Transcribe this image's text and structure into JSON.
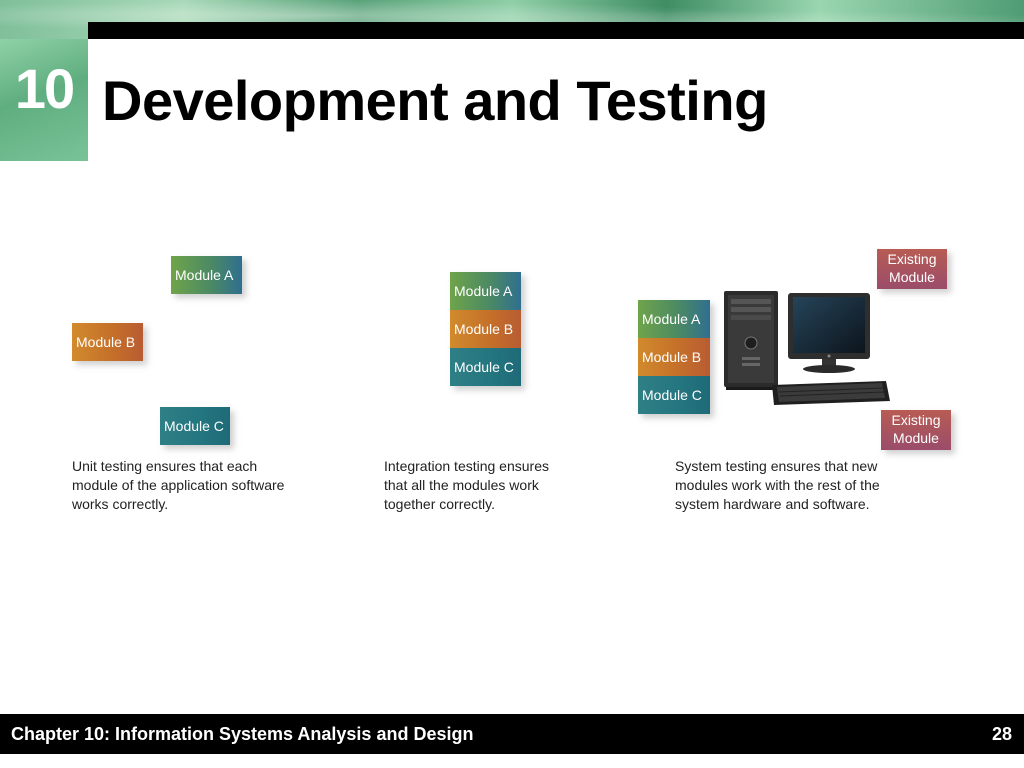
{
  "slide": {
    "chapter_number": "10",
    "title": "Development and Testing"
  },
  "unit_testing": {
    "modules": [
      "Module A",
      "Module B",
      "Module C"
    ],
    "caption_lines": [
      "Unit testing ensures that each",
      "module of the application software",
      "works correctly."
    ]
  },
  "integration_testing": {
    "modules": [
      "Module A",
      "Module B",
      "Module C"
    ],
    "caption_lines": [
      "Integration testing ensures",
      "that all the modules work",
      "together correctly."
    ]
  },
  "system_testing": {
    "modules": [
      "Module A",
      "Module B",
      "Module C"
    ],
    "existing_top": [
      "Existing",
      "Module"
    ],
    "existing_bottom": [
      "Existing",
      "Module"
    ],
    "caption_lines": [
      "System testing ensures that new",
      "modules work with the rest of the",
      "system hardware and software."
    ]
  },
  "footer": {
    "text": "Chapter 10: Information Systems Analysis and Design",
    "page_number": "28"
  },
  "colors": {
    "module_a": "#4c8a63",
    "module_b": "#c46e2a",
    "module_c": "#23757f",
    "existing_module": "#9a4c6a",
    "header_green": "#5fae80"
  }
}
